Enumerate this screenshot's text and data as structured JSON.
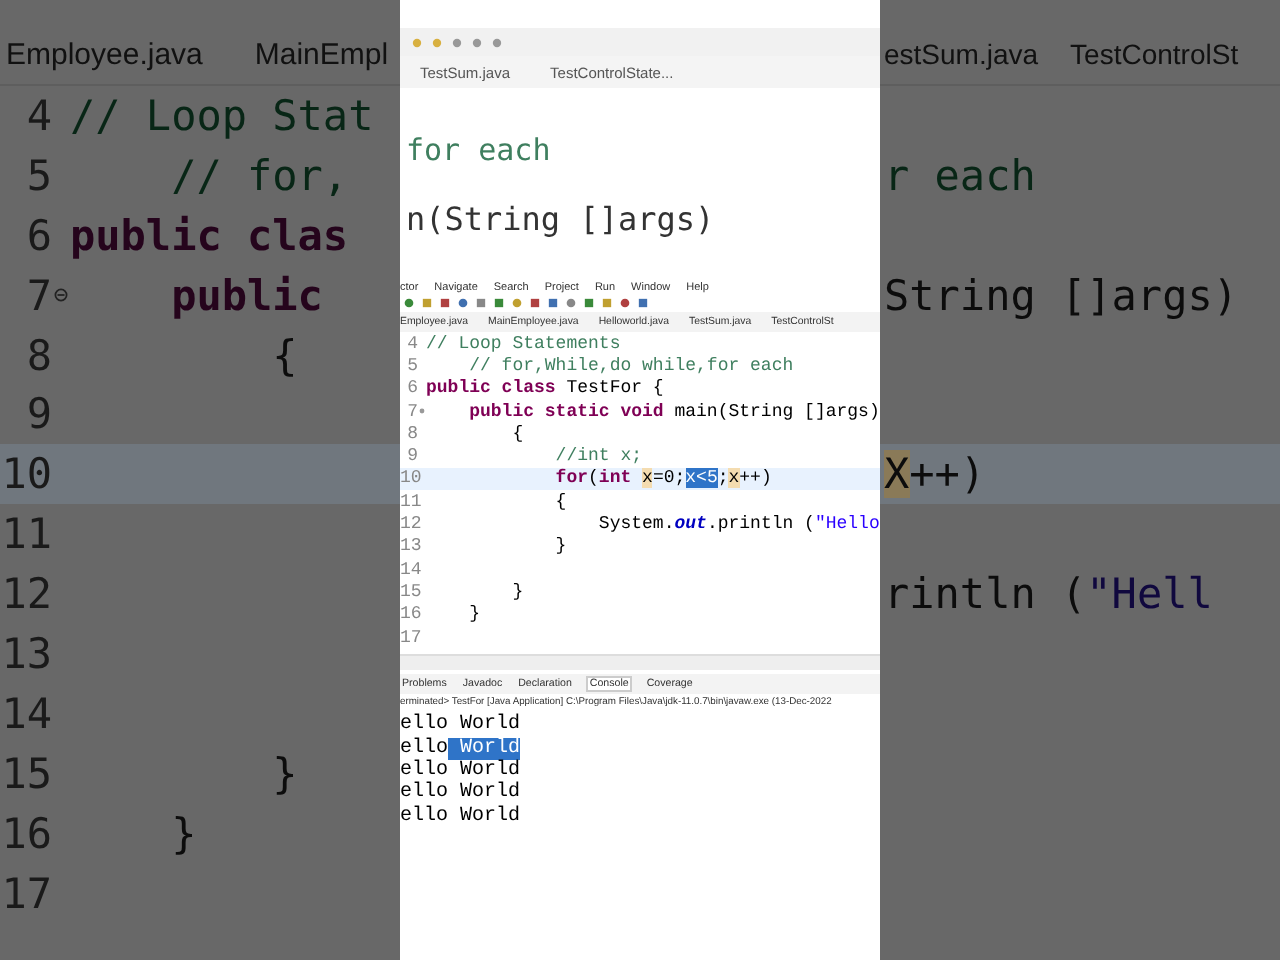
{
  "left_zoom": {
    "tabs": [
      "Employee.java",
      "MainEmpl"
    ],
    "lines": [
      {
        "number": "4",
        "current": false,
        "foldable": false,
        "tokens": [
          {
            "text": "// Loop Stat",
            "kind": "comment"
          }
        ]
      },
      {
        "number": "5",
        "current": false,
        "foldable": false,
        "tokens": [
          {
            "text": "    // for,",
            "kind": "comment"
          }
        ]
      },
      {
        "number": "6",
        "current": false,
        "foldable": false,
        "tokens": [
          {
            "text": "public clas",
            "kind": "keyword"
          }
        ]
      },
      {
        "number": "7",
        "current": false,
        "foldable": true,
        "tokens": [
          {
            "text": "    public",
            "kind": "keyword"
          }
        ]
      },
      {
        "number": "8",
        "current": false,
        "foldable": false,
        "tokens": [
          {
            "text": "        {",
            "kind": "plain"
          }
        ]
      },
      {
        "number": "9",
        "current": false,
        "foldable": false
      },
      {
        "number": "10",
        "current": true,
        "foldable": false
      },
      {
        "number": "11",
        "current": false,
        "foldable": false
      },
      {
        "number": "12",
        "current": false,
        "foldable": false
      },
      {
        "number": "13",
        "current": false,
        "foldable": false
      },
      {
        "number": "14",
        "current": false,
        "foldable": false
      },
      {
        "number": "15",
        "current": false,
        "foldable": false,
        "tokens": [
          {
            "text": "        }",
            "kind": "plain"
          }
        ]
      },
      {
        "number": "16",
        "current": false,
        "foldable": false,
        "tokens": [
          {
            "text": "    }",
            "kind": "plain"
          }
        ]
      },
      {
        "number": "17",
        "current": false,
        "foldable": false
      }
    ]
  },
  "center": {
    "preview": {
      "tabs": [
        "TestSum.java",
        "TestControlState..."
      ],
      "lines": [
        {
          "tokens": [
            {
              "text": "for each",
              "kind": "comment"
            }
          ]
        },
        {
          "tokens": [
            {
              "text": "n(String []args)",
              "kind": "plain"
            }
          ]
        }
      ]
    },
    "menu": [
      "ctor",
      "Navigate",
      "Search",
      "Project",
      "Run",
      "Window",
      "Help"
    ],
    "editor": {
      "tabs": [
        "Employee.java",
        "MainEmployee.java",
        "Helloworld.java",
        "TestSum.java",
        "TestControlSt"
      ],
      "lines": [
        {
          "number": "4",
          "current": false,
          "foldable": false,
          "tokens": [
            {
              "text": "// Loop Statements",
              "kind": "comment"
            }
          ]
        },
        {
          "number": "5",
          "current": false,
          "foldable": false,
          "tokens": [
            {
              "text": "    // for,While,do while,for each",
              "kind": "comment"
            }
          ]
        },
        {
          "number": "6",
          "current": false,
          "foldable": false,
          "tokens": [
            {
              "text": "public class",
              "kind": "keyword"
            },
            {
              "text": " TestFor {",
              "kind": "plain"
            }
          ]
        },
        {
          "number": "7",
          "current": false,
          "foldable": true,
          "tokens": [
            {
              "text": "    public static void",
              "kind": "keyword"
            },
            {
              "text": " main(String []args)",
              "kind": "plain"
            }
          ]
        },
        {
          "number": "8",
          "current": false,
          "foldable": false,
          "tokens": [
            {
              "text": "        {",
              "kind": "plain"
            }
          ]
        },
        {
          "number": "9",
          "current": false,
          "foldable": false,
          "tokens": [
            {
              "text": "            //int x;",
              "kind": "comment"
            }
          ]
        },
        {
          "number": "10",
          "current": true,
          "foldable": false,
          "tokens": [
            {
              "text": "            for",
              "kind": "keyword"
            },
            {
              "text": "(",
              "kind": "plain"
            },
            {
              "text": "int ",
              "kind": "keyword"
            },
            {
              "text": "x",
              "kind": "occurrence"
            },
            {
              "text": "=0;",
              "kind": "plain"
            },
            {
              "text": "x<5",
              "kind": "selection"
            },
            {
              "text": ";",
              "kind": "plain"
            },
            {
              "text": "x",
              "kind": "occurrence"
            },
            {
              "text": "++)",
              "kind": "plain"
            }
          ]
        },
        {
          "number": "11",
          "current": false,
          "foldable": false,
          "tokens": [
            {
              "text": "            {",
              "kind": "plain"
            }
          ]
        },
        {
          "number": "12",
          "current": false,
          "foldable": false,
          "tokens": [
            {
              "text": "                System.",
              "kind": "plain"
            },
            {
              "text": "out",
              "kind": "field"
            },
            {
              "text": ".println (",
              "kind": "plain"
            },
            {
              "text": "\"Hello",
              "kind": "string"
            }
          ]
        },
        {
          "number": "13",
          "current": false,
          "foldable": false,
          "tokens": [
            {
              "text": "            }",
              "kind": "plain"
            }
          ]
        },
        {
          "number": "14",
          "current": false,
          "foldable": false
        },
        {
          "number": "15",
          "current": false,
          "foldable": false,
          "tokens": [
            {
              "text": "        }",
              "kind": "plain"
            }
          ]
        },
        {
          "number": "16",
          "current": false,
          "foldable": false,
          "tokens": [
            {
              "text": "    }",
              "kind": "plain"
            }
          ]
        },
        {
          "number": "17",
          "current": false,
          "foldable": false
        }
      ]
    },
    "console": {
      "tabs": [
        {
          "label": "Problems",
          "selected": false
        },
        {
          "label": "Javadoc",
          "selected": false
        },
        {
          "label": "Declaration",
          "selected": false
        },
        {
          "label": "Console",
          "selected": true
        },
        {
          "label": "Coverage",
          "selected": false
        }
      ],
      "status": "erminated> TestFor [Java Application] C:\\Program Files\\Java\\jdk-11.0.7\\bin\\javaw.exe (13-Dec-2022",
      "output": [
        {
          "tokens": [
            {
              "text": "ello World",
              "kind": "plain"
            }
          ]
        },
        {
          "tokens": [
            {
              "text": "ello",
              "kind": "plain"
            },
            {
              "text": " World",
              "kind": "selection"
            }
          ]
        },
        {
          "tokens": [
            {
              "text": "ello World",
              "kind": "plain"
            }
          ]
        },
        {
          "tokens": [
            {
              "text": "ello World",
              "kind": "plain"
            }
          ]
        },
        {
          "tokens": [
            {
              "text": "ello World",
              "kind": "plain"
            }
          ]
        }
      ]
    }
  },
  "right_zoom": {
    "tabs": [
      "estSum.java",
      "TestControlSt"
    ],
    "lines": [
      {
        "current": false
      },
      {
        "current": false,
        "tokens": [
          {
            "text": "r each",
            "kind": "comment"
          }
        ]
      },
      {
        "current": false
      },
      {
        "current": false,
        "tokens": [
          {
            "text": "String []args)",
            "kind": "plain"
          }
        ]
      },
      {
        "current": false
      },
      {
        "current": false
      },
      {
        "current": true,
        "tokens": [
          {
            "text": "X",
            "kind": "occurrence"
          },
          {
            "text": "++)",
            "kind": "plain"
          }
        ]
      },
      {
        "current": false
      },
      {
        "current": false,
        "tokens": [
          {
            "text": "rintln (",
            "kind": "plain"
          },
          {
            "text": "\"Hell",
            "kind": "string"
          }
        ]
      },
      {
        "current": false
      },
      {
        "current": false
      },
      {
        "current": false
      },
      {
        "current": false
      },
      {
        "current": false
      }
    ]
  }
}
